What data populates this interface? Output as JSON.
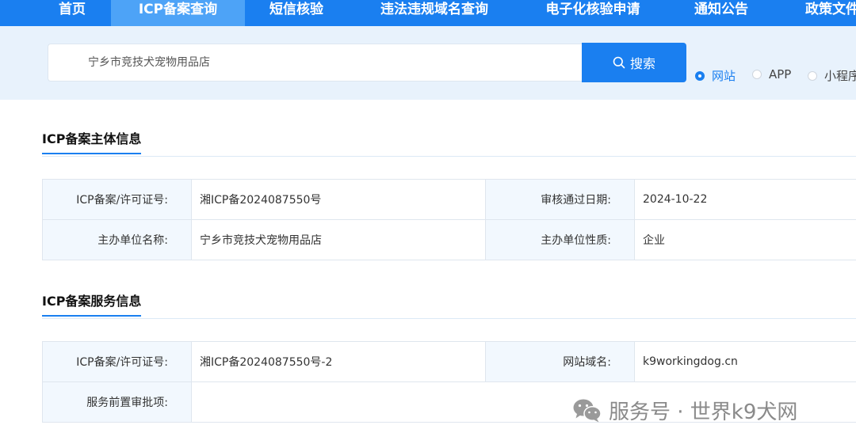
{
  "nav": {
    "items": [
      {
        "label": "首页",
        "active": false
      },
      {
        "label": "ICP备案查询",
        "active": true
      },
      {
        "label": "短信核验",
        "active": false
      },
      {
        "label": "违法违规域名查询",
        "active": false
      },
      {
        "label": "电子化核验申请",
        "active": false
      },
      {
        "label": "通知公告",
        "active": false
      },
      {
        "label": "政策文件",
        "active": false
      }
    ]
  },
  "search": {
    "value": "宁乡市竞技犬宠物用品店",
    "button_label": "搜索",
    "options": [
      {
        "label": "网站",
        "checked": true
      },
      {
        "label": "APP",
        "checked": false
      },
      {
        "label": "小程序",
        "checked": false
      }
    ]
  },
  "subject_info": {
    "title": "ICP备案主体信息",
    "rows": [
      {
        "label1": "ICP备案/许可证号:",
        "value1": "湘ICP备2024087550号",
        "label2": "审核通过日期:",
        "value2": "2024-10-22"
      },
      {
        "label1": "主办单位名称:",
        "value1": "宁乡市竞技犬宠物用品店",
        "label2": "主办单位性质:",
        "value2": "企业"
      }
    ]
  },
  "service_info": {
    "title": "ICP备案服务信息",
    "rows": [
      {
        "label1": "ICP备案/许可证号:",
        "value1": "湘ICP备2024087550号-2",
        "label2": "网站域名:",
        "value2": "k9workingdog.cn"
      },
      {
        "label1": "服务前置审批项:",
        "value1": "",
        "label2": "",
        "value2": ""
      }
    ]
  },
  "watermark": {
    "text": "服务号 · 世界k9犬网"
  },
  "colors": {
    "primary": "#1a7ff0",
    "nav_active": "#4da3f7",
    "search_band": "#e8f2fc",
    "label_bg": "#f2f8fe"
  }
}
